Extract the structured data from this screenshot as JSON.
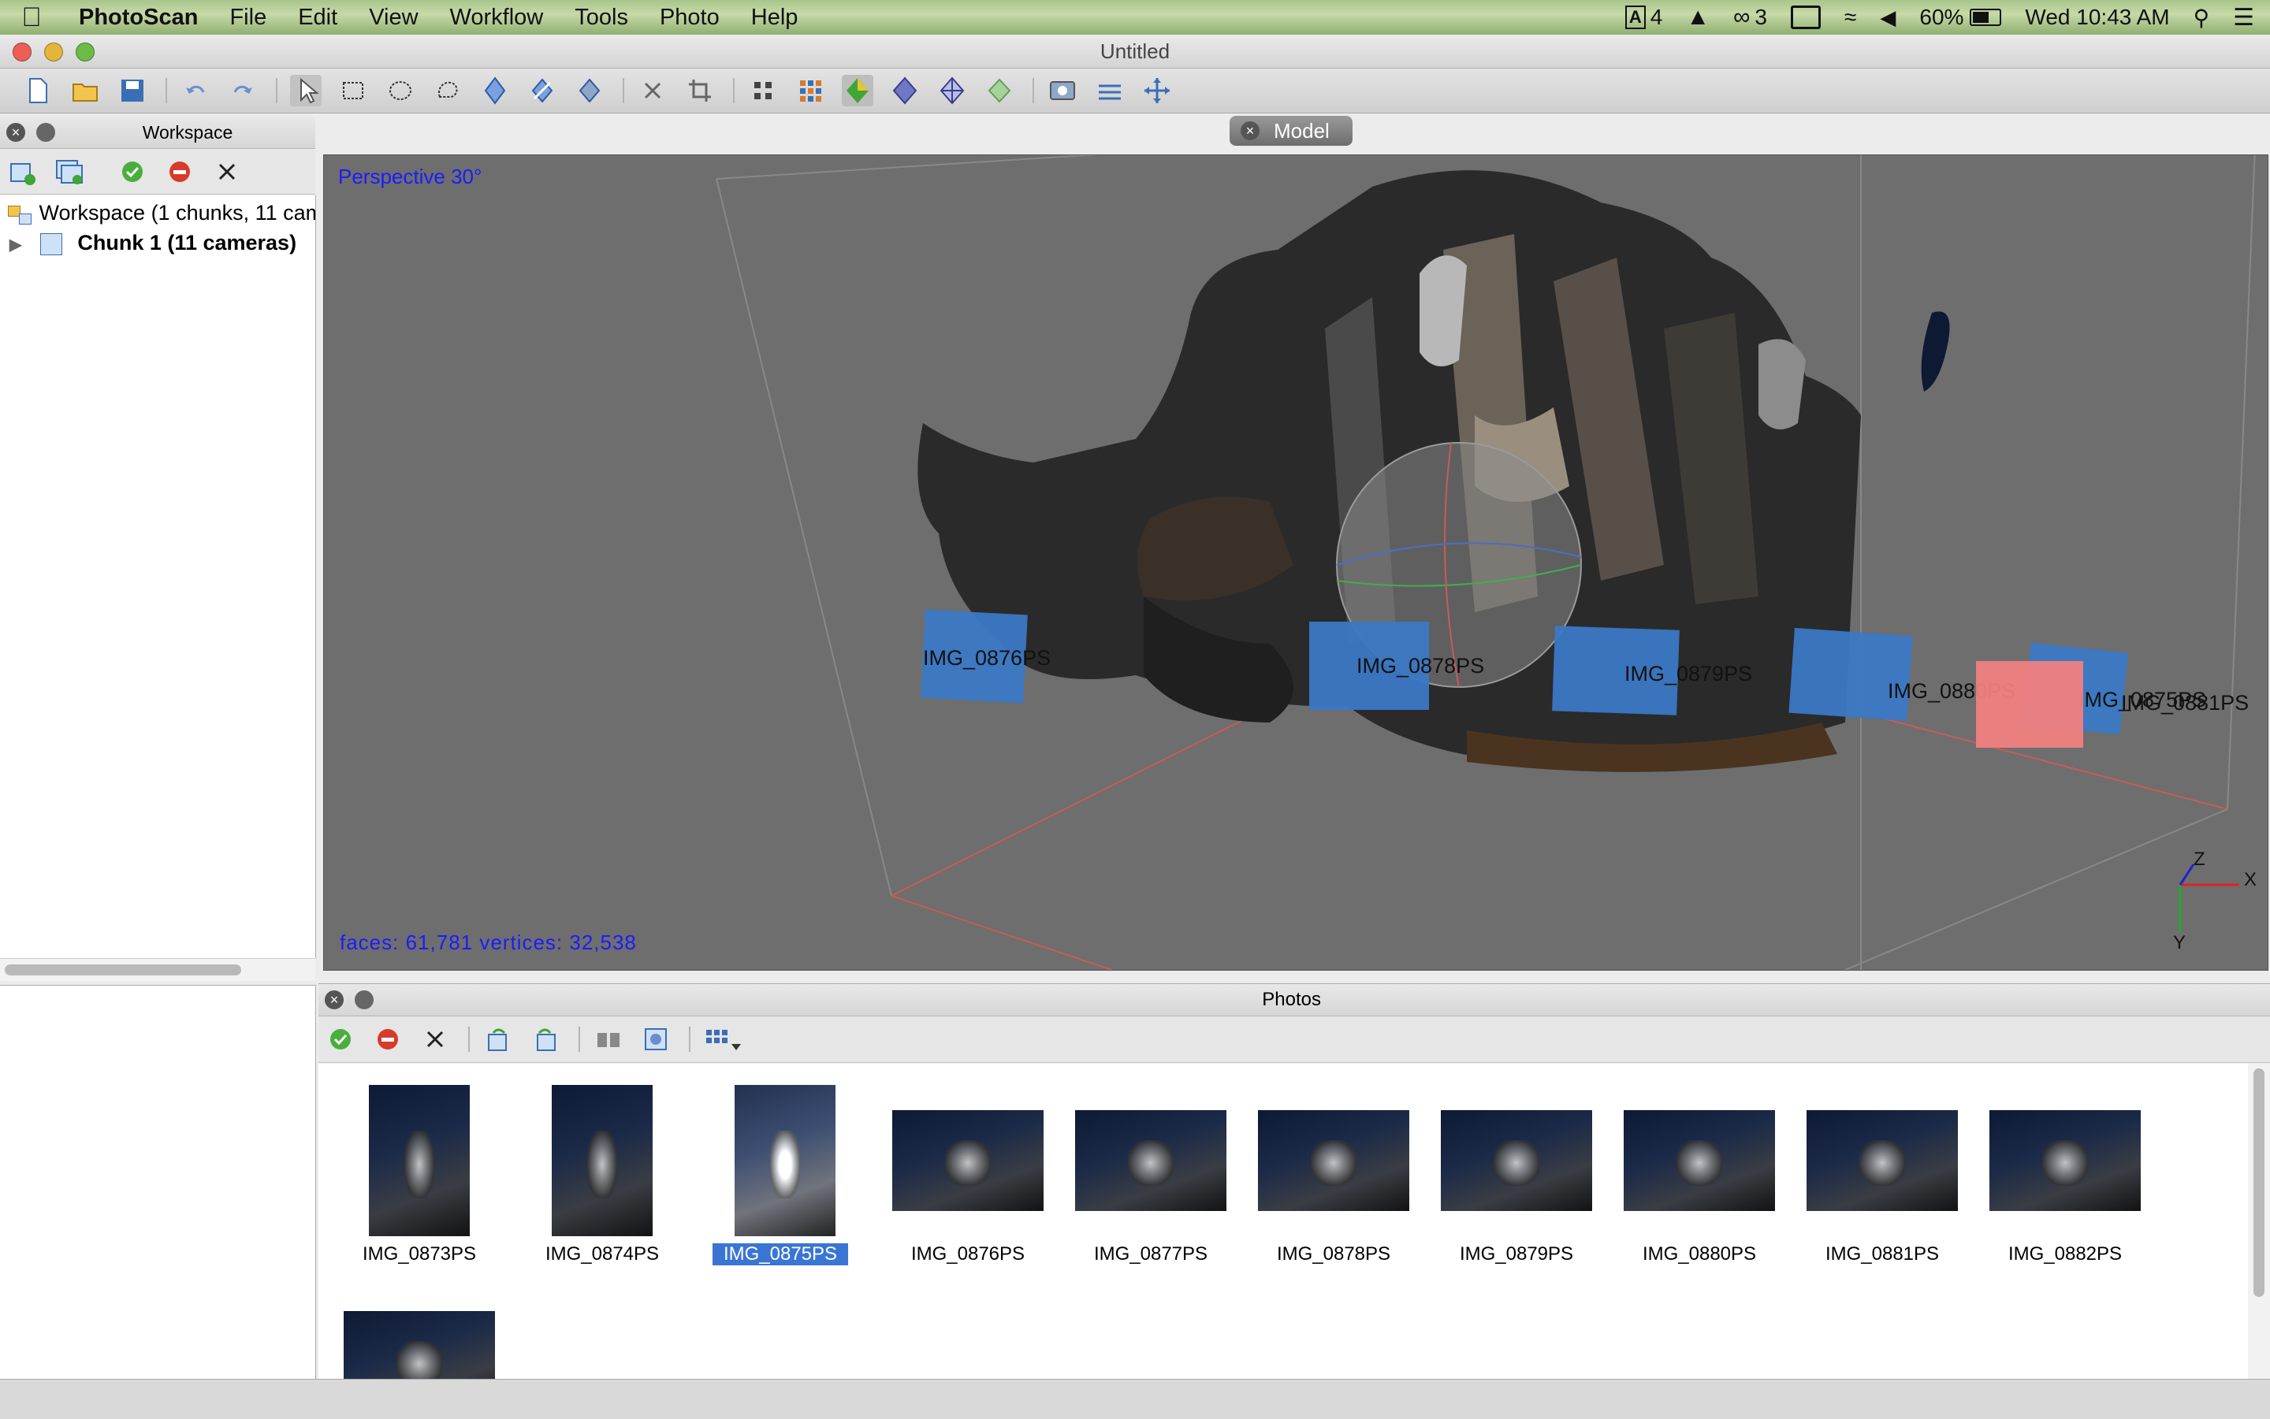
{
  "menubar": {
    "app": "PhotoScan",
    "items": [
      "File",
      "Edit",
      "View",
      "Workflow",
      "Tools",
      "Photo",
      "Help"
    ],
    "status": {
      "adobe_count": "4",
      "cc_count": "3",
      "battery": "60%",
      "clock": "Wed 10:43 AM"
    }
  },
  "window": {
    "title": "Untitled"
  },
  "workspace": {
    "title": "Workspace",
    "root": "Workspace (1 chunks, 11 cameras)",
    "chunk": "Chunk 1 (11 cameras)"
  },
  "model": {
    "tab": "Model",
    "projection": "Perspective 30°",
    "stats": "faces: 61,781 vertices: 32,538",
    "axes": {
      "x": "X",
      "y": "Y",
      "z": "Z"
    },
    "cameras": [
      {
        "label": "IMG_0876PS"
      },
      {
        "label": "IMG_0878PS"
      },
      {
        "label": "IMG_0879PS"
      },
      {
        "label": "IMG_0880PS"
      },
      {
        "label": "IMG_0875PS"
      },
      {
        "label": "IMG_0881PS"
      }
    ]
  },
  "photos": {
    "title": "Photos",
    "items": [
      {
        "name": "IMG_0873PS"
      },
      {
        "name": "IMG_0874PS"
      },
      {
        "name": "IMG_0875PS",
        "selected": true
      },
      {
        "name": "IMG_0876PS"
      },
      {
        "name": "IMG_0877PS"
      },
      {
        "name": "IMG_0878PS"
      },
      {
        "name": "IMG_0879PS"
      },
      {
        "name": "IMG_0880PS"
      },
      {
        "name": "IMG_0881PS"
      },
      {
        "name": "IMG_0882PS"
      }
    ]
  },
  "colors": {
    "camera": "#3a78c4",
    "selected_camera": "#f08080",
    "overlay_text": "#1b1bff",
    "selection": "#3a75d4"
  }
}
